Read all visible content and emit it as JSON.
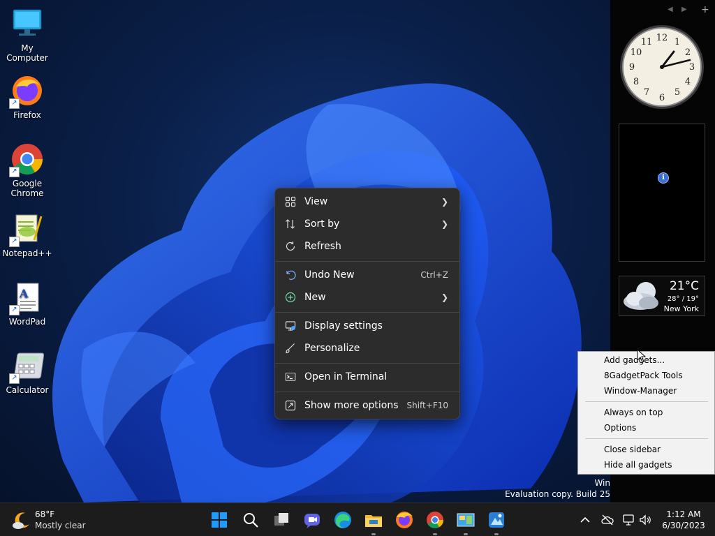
{
  "desktop": {
    "icons": [
      {
        "label": "My Computer"
      },
      {
        "label": "Firefox"
      },
      {
        "label": "Google Chrome"
      },
      {
        "label": "Notepad++"
      },
      {
        "label": "WordPad"
      },
      {
        "label": "Calculator"
      }
    ],
    "watermark_line1": "Win",
    "watermark_line2": "Evaluation copy. Build 25"
  },
  "context_menu": {
    "items": [
      {
        "label": "View",
        "icon": "grid-icon",
        "submenu": true
      },
      {
        "label": "Sort by",
        "icon": "sort-icon",
        "submenu": true
      },
      {
        "label": "Refresh",
        "icon": "refresh-icon"
      },
      {
        "label": "Undo New",
        "icon": "undo-icon",
        "shortcut": "Ctrl+Z"
      },
      {
        "label": "New",
        "icon": "plus-circle-icon",
        "submenu": true
      },
      {
        "label": "Display settings",
        "icon": "display-icon"
      },
      {
        "label": "Personalize",
        "icon": "brush-icon"
      },
      {
        "label": "Open in Terminal",
        "icon": "terminal-icon"
      },
      {
        "label": "Show more options",
        "icon": "more-options-icon",
        "shortcut": "Shift+F10"
      }
    ]
  },
  "sidebar": {
    "weather": {
      "temp": "21°C",
      "range": "28° / 19°",
      "city": "New York"
    }
  },
  "gadget_menu": {
    "items": [
      "Add gadgets...",
      "8GadgetPack Tools",
      "Window-Manager",
      "Always on top",
      "Options",
      "Close sidebar",
      "Hide all gadgets"
    ]
  },
  "taskbar": {
    "weather_temp": "68°F",
    "weather_desc": "Mostly clear",
    "time": "1:12 AM",
    "date": "6/30/2023"
  },
  "colors": {
    "accent": "#0078d4",
    "menu_bg": "#2c2c2c",
    "taskbar_bg": "#1c1c1c"
  }
}
